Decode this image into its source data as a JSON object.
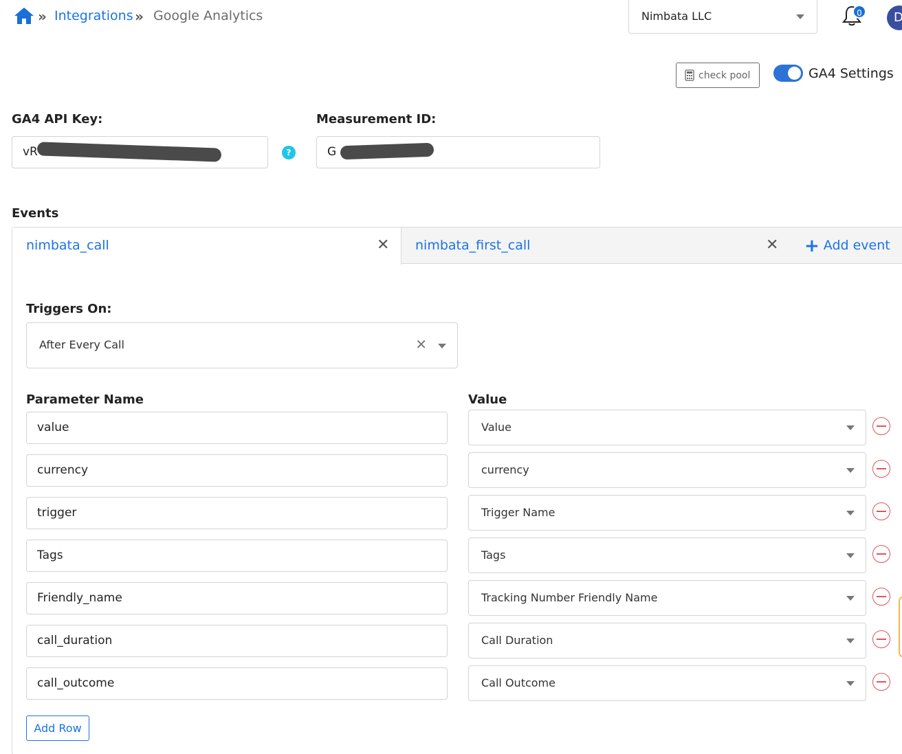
{
  "breadcrumb": {
    "home_icon": "home-icon",
    "separator": "»",
    "link": "Integrations",
    "current": "Google Analytics"
  },
  "header": {
    "company": "Nimbata LLC",
    "notifications_count": "0",
    "avatar_initial": "D"
  },
  "toolbar": {
    "check_pool_label": "check pool",
    "ga4_toggle_label": "GA4 Settings",
    "ga4_toggle_on": true
  },
  "keys": {
    "api_key_label": "GA4 API Key:",
    "api_key_value": "vR",
    "measurement_label": "Measurement ID:",
    "measurement_value": "G"
  },
  "events": {
    "title": "Events",
    "tabs": [
      {
        "label": "nimbata_call",
        "active": true
      },
      {
        "label": "nimbata_first_call",
        "active": false
      }
    ],
    "add_event_label": "Add event",
    "triggers_label": "Triggers On:",
    "triggers_value": "After Every Call",
    "param_header": "Parameter Name",
    "value_header": "Value",
    "rows": [
      {
        "param": "value",
        "value": "Value"
      },
      {
        "param": "currency",
        "value": "currency"
      },
      {
        "param": "trigger",
        "value": "Trigger Name"
      },
      {
        "param": "Tags",
        "value": "Tags"
      },
      {
        "param": "Friendly_name",
        "value": "Tracking Number Friendly Name"
      },
      {
        "param": "call_duration",
        "value": "Call Duration"
      },
      {
        "param": "call_outcome",
        "value": "Call Outcome"
      }
    ],
    "add_row_label": "Add Row"
  },
  "colors": {
    "accent": "#1a73e8",
    "toggle": "#2b73d6",
    "remove": "#e0545a",
    "help": "#1fc6e8"
  }
}
